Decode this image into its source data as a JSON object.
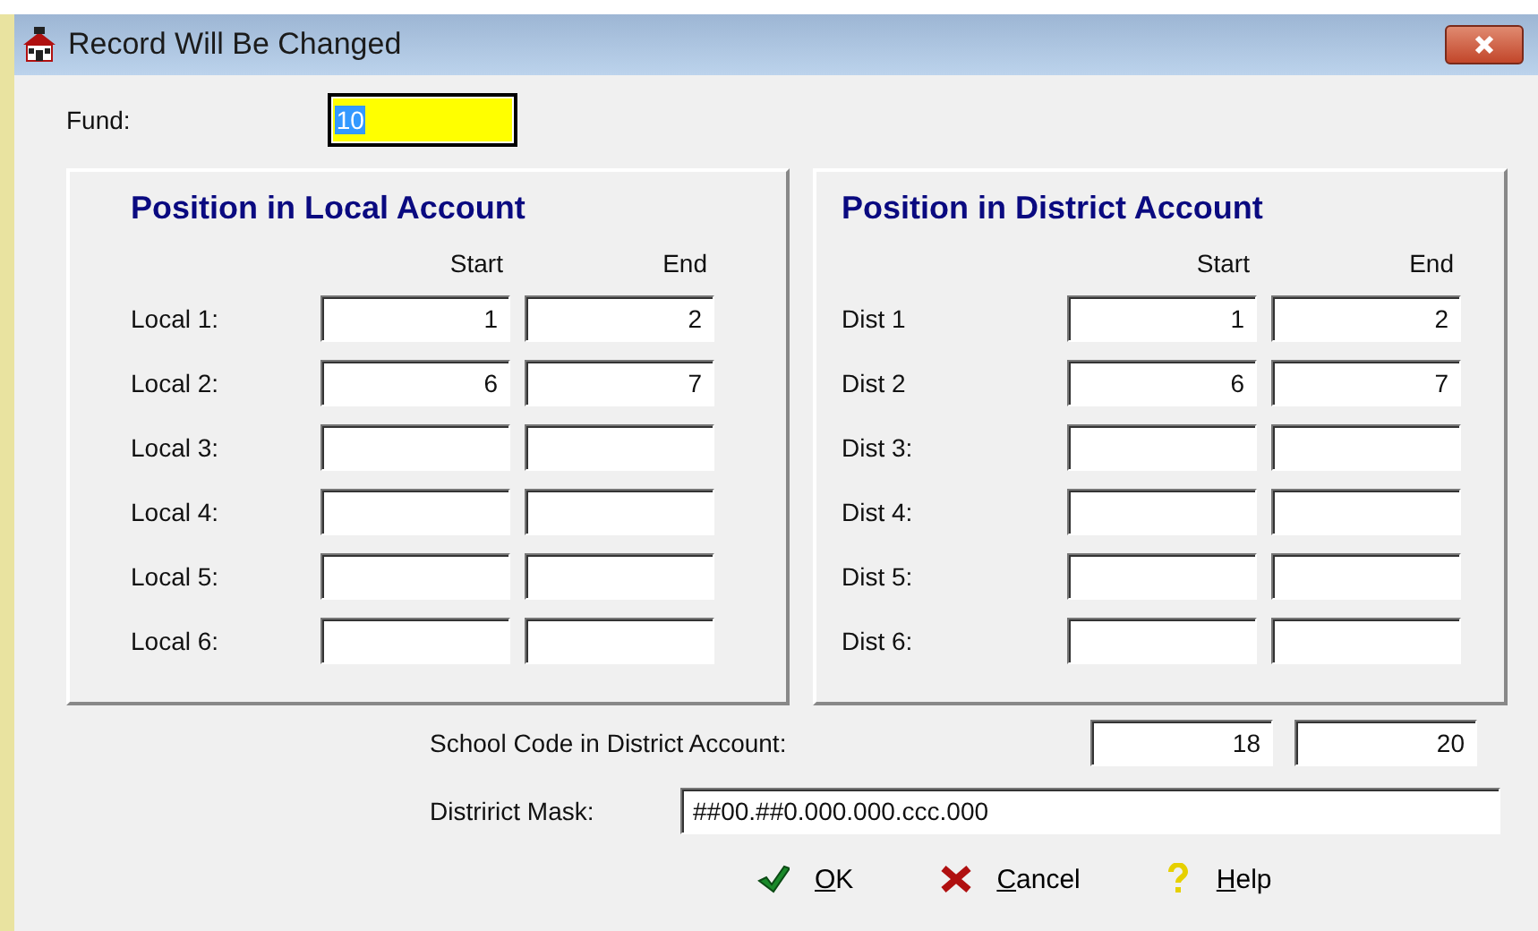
{
  "window": {
    "title": "Record Will Be Changed"
  },
  "fund": {
    "label": "Fund:",
    "value": "10",
    "text_selected": true
  },
  "panels": [
    {
      "title": "Position in Local Account",
      "columns": [
        "Start",
        "End"
      ],
      "rows": [
        {
          "label": "Local 1:",
          "start": "1",
          "end": "2"
        },
        {
          "label": "Local 2:",
          "start": "6",
          "end": "7"
        },
        {
          "label": "Local 3:"
        },
        {
          "label": "Local 4:"
        },
        {
          "label": "Local 5:"
        },
        {
          "label": "Local 6:"
        }
      ]
    },
    {
      "title": "Position in District Account",
      "columns": [
        "Start",
        "End"
      ],
      "rows": [
        {
          "label": "Dist 1",
          "start": "1",
          "end": "2"
        },
        {
          "label": "Dist 2",
          "start": "6",
          "end": "7"
        },
        {
          "label": "Dist 3:"
        },
        {
          "label": "Dist 4:"
        },
        {
          "label": "Dist 5:"
        },
        {
          "label": "Dist 6:"
        }
      ]
    }
  ],
  "school_code": {
    "label": "School Code in District Account:",
    "start": "18",
    "end": "20"
  },
  "mask": {
    "label": "Distririct Mask:",
    "value": "##00.##0.000.000.ccc.000"
  },
  "buttons": [
    {
      "kind": "ok",
      "label": "OK"
    },
    {
      "kind": "cancel",
      "label": "Cancel"
    },
    {
      "kind": "help",
      "label": "Help"
    }
  ]
}
